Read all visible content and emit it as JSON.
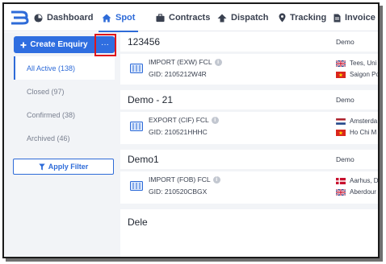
{
  "nav": {
    "items": [
      {
        "label": "Dashboard",
        "icon": "dashboard-icon"
      },
      {
        "label": "Spot",
        "icon": "home-icon",
        "active": true
      },
      {
        "label": "Contracts",
        "icon": "briefcase-icon"
      },
      {
        "label": "Dispatch",
        "icon": "dispatch-icon"
      },
      {
        "label": "Tracking",
        "icon": "map-pin-icon"
      },
      {
        "label": "Invoice M",
        "icon": "document-icon"
      }
    ]
  },
  "sidebar": {
    "create_label": "Create Enquiry",
    "more_label": "···",
    "filters": [
      {
        "label": "All Active (138)",
        "active": true
      },
      {
        "label": "Closed (97)"
      },
      {
        "label": "Confirmed (38)"
      },
      {
        "label": "Archived (46)"
      }
    ],
    "apply_label": "Apply Filter"
  },
  "enquiries": [
    {
      "title": "123456",
      "owner": "Demo",
      "mode": "IMPORT (EXW) FCL",
      "gid": "GID: 2105212W4R",
      "origin": {
        "label": "Tees, Uni",
        "flag": "uk-flag"
      },
      "destination": {
        "label": "Saigon Po",
        "flag": "vietnam-flag"
      }
    },
    {
      "title": "Demo - 21",
      "owner": "Demo",
      "mode": "EXPORT (CIF) FCL",
      "gid": "GID: 210521HHHC",
      "origin": {
        "label": "Amsterda",
        "flag": "netherlands-flag"
      },
      "destination": {
        "label": "Ho Chi M",
        "flag": "vietnam-flag"
      }
    },
    {
      "title": "Demo1",
      "owner": "Demo",
      "mode": "IMPORT (FOB) FCL",
      "gid": "GID: 210520CBGX",
      "origin": {
        "label": "Aarhus, D",
        "flag": "denmark-flag"
      },
      "destination": {
        "label": "Aberdour",
        "flag": "uk-flag"
      }
    },
    {
      "title": "Dele",
      "owner": "",
      "mode": "",
      "gid": "",
      "origin": null,
      "destination": null
    }
  ],
  "colors": {
    "accent": "#2e6bd8",
    "button": "#2f6ee0",
    "highlight": "#e0151b",
    "background": "#f2f4f7"
  }
}
